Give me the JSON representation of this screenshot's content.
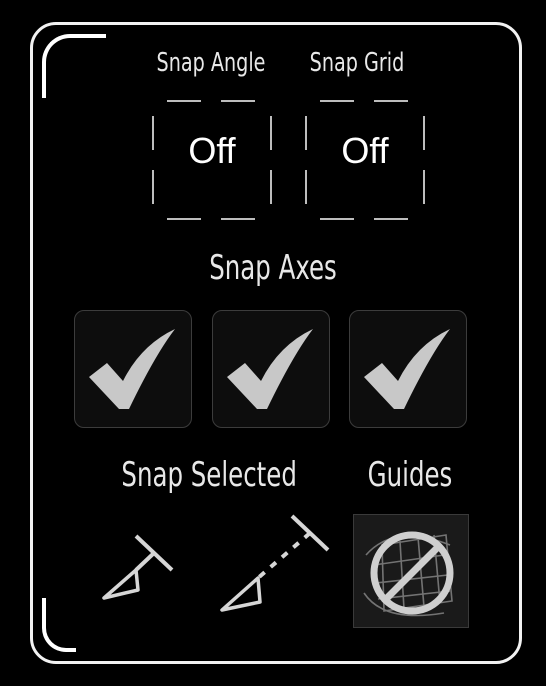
{
  "snap": {
    "angle_label": "Snap Angle",
    "grid_label": "Snap Grid",
    "angle_value": "Off",
    "grid_value": "Off"
  },
  "axes": {
    "label": "Snap Axes",
    "x_checked": true,
    "y_checked": true,
    "z_checked": true
  },
  "selected": {
    "label": "Snap Selected"
  },
  "guides": {
    "label": "Guides",
    "state": "disabled"
  },
  "icons": {
    "checkbox": "check-icon",
    "snap_selected_solid": "snap-selected-solid-icon",
    "snap_selected_dashed": "snap-selected-dashed-icon",
    "guides_off": "guides-disabled-icon"
  },
  "colors": {
    "background": "#000000",
    "border": "#f2f2f2",
    "check": "#c8c8c8",
    "text": "#e8e8e8"
  }
}
